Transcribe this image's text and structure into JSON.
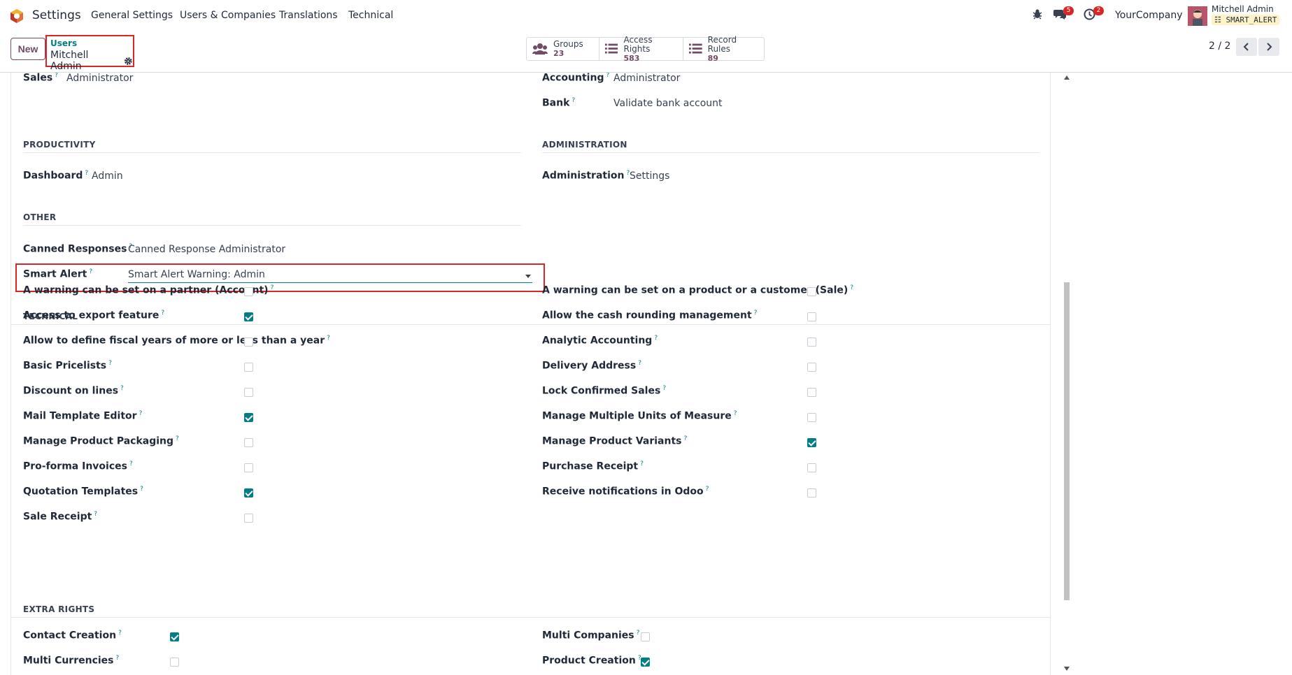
{
  "nav": {
    "app_name": "Settings",
    "menu": [
      "General Settings",
      "Users & Companies",
      "Translations",
      "Technical"
    ],
    "messages_count": "5",
    "activities_count": "2",
    "company": "YourCompany",
    "user_name": "Mitchell Admin",
    "db_name": "SMART_ALERT"
  },
  "control": {
    "new_label": "New",
    "breadcrumb_parent": "Users",
    "breadcrumb_current": "Mitchell Admin",
    "stats": [
      {
        "label": "Groups",
        "value": "23",
        "icon": "users-icon"
      },
      {
        "label": "Access Rights",
        "value": "583",
        "icon": "list-icon"
      },
      {
        "label": "Record Rules",
        "value": "89",
        "icon": "list-icon"
      }
    ],
    "pager": "2 / 2"
  },
  "form": {
    "top_left": {
      "label": "Sales",
      "value": "Administrator"
    },
    "top_right": [
      {
        "label": "Accounting",
        "value": "Administrator"
      },
      {
        "label": "Bank",
        "value": "Validate bank account"
      }
    ],
    "productivity": {
      "title": "PRODUCTIVITY",
      "label": "Dashboard",
      "value": "Admin"
    },
    "administration": {
      "title": "ADMINISTRATION",
      "label": "Administration",
      "value": "Settings"
    },
    "other": {
      "title": "OTHER",
      "canned": {
        "label": "Canned Responses",
        "value": "Canned Response Administrator"
      },
      "smart_alert": {
        "label": "Smart Alert",
        "value": "Smart Alert Warning: Admin"
      }
    },
    "technical": {
      "title": "TECHNICAL",
      "left": [
        {
          "label": "A warning can be set on a partner (Account)",
          "checked": false
        },
        {
          "label": "Access to export feature",
          "checked": true
        },
        {
          "label": "Allow to define fiscal years of more or less than a year",
          "checked": false
        },
        {
          "label": "Basic Pricelists",
          "checked": false
        },
        {
          "label": "Discount on lines",
          "checked": false
        },
        {
          "label": "Mail Template Editor",
          "checked": true
        },
        {
          "label": "Manage Product Packaging",
          "checked": false
        },
        {
          "label": "Pro-forma Invoices",
          "checked": false
        },
        {
          "label": "Quotation Templates",
          "checked": true
        },
        {
          "label": "Sale Receipt",
          "checked": false
        }
      ],
      "right": [
        {
          "label": "A warning can be set on a product or a customer (Sale)",
          "checked": false
        },
        {
          "label": "Allow the cash rounding management",
          "checked": false
        },
        {
          "label": "Analytic Accounting",
          "checked": false
        },
        {
          "label": "Delivery Address",
          "checked": false
        },
        {
          "label": "Lock Confirmed Sales",
          "checked": false
        },
        {
          "label": "Manage Multiple Units of Measure",
          "checked": false
        },
        {
          "label": "Manage Product Variants",
          "checked": true
        },
        {
          "label": "Purchase Receipt",
          "checked": false
        },
        {
          "label": "Receive notifications in Odoo",
          "checked": false
        }
      ]
    },
    "extra": {
      "title": "EXTRA RIGHTS",
      "left": [
        {
          "label": "Contact Creation",
          "checked": true
        },
        {
          "label": "Multi Currencies",
          "checked": false
        }
      ],
      "right": [
        {
          "label": "Multi Companies",
          "checked": false
        },
        {
          "label": "Product Creation",
          "checked": true
        }
      ]
    }
  },
  "colors": {
    "brand": "#714b67",
    "accent": "#017e84",
    "highlight": "#dc2626"
  }
}
